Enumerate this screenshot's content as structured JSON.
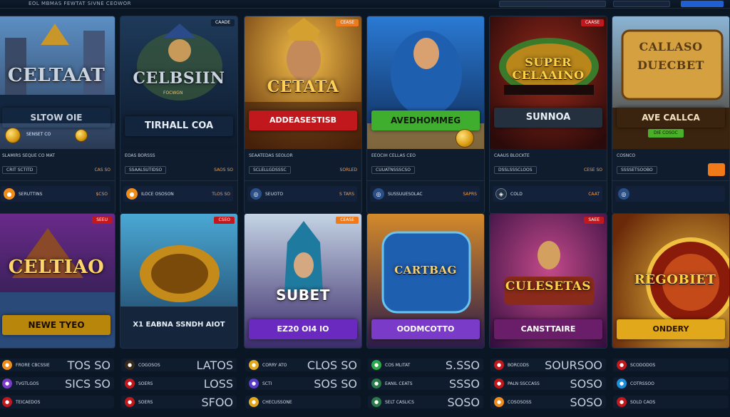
{
  "topbar": {
    "brand": "EOL MBMAS FEWTAT SIVNE CEOWOR"
  },
  "row1": [
    {
      "tag": "",
      "tag_color": "#1d5fd6",
      "logo": "CELTAAT",
      "logo_color": "#ffd46a",
      "banner": "SLTOW OIE",
      "banner_sub": "SENSET CO",
      "banner_bg": "#1d5fd6",
      "banner_fg": "#e8f2ff",
      "meta": "SLAMIRS SEQUE CO MAT",
      "chip": "CRIT SCTITD",
      "amount": "CAS SO",
      "pay_icon": "coin",
      "pay_color": "#f08c1a",
      "pay_label": "SERUTTINS",
      "pay_amount": "$CSO"
    },
    {
      "tag": "CAADE",
      "tag_color": "#12243a",
      "logo": "CELBSIIN",
      "logo_color": "#e7c470",
      "banner": "TIRHALL COA",
      "banner_sub": "FOCWGN",
      "banner_bg": "#13253c",
      "banner_fg": "#e6edf5",
      "meta": "EOAS BORSSS",
      "chip": "SSAALSUTIDSO",
      "amount": "SAOS SO",
      "pay_icon": "coin",
      "pay_color": "#f08c1a",
      "pay_label": "ILOCE OSOSON",
      "pay_amount": "TLOS SO"
    },
    {
      "tag": "CEASE",
      "tag_color": "#f07a1a",
      "logo": "CETATA",
      "logo_color": "#ffcf5a",
      "banner": "ADDEASESTISB",
      "banner_sub": "",
      "banner_bg": "#c0181c",
      "banner_fg": "#ffffff",
      "meta": "SEAATEDAS SEOLOR",
      "chip": "SCLELLGDSSSC",
      "amount": "SORLED",
      "pay_icon": "globe",
      "pay_color": "#2a4f86",
      "pay_label": "SEUOTO",
      "pay_amount": "S TARS"
    },
    {
      "tag": "",
      "tag_color": "#1d5fd6",
      "logo": "",
      "logo_color": "#ffffff",
      "banner": "AVEDHOMMEG",
      "banner_sub": "",
      "banner_bg": "#3fae2e",
      "banner_fg": "#0b1d07",
      "meta": "EEOCIH CELLAS CEO",
      "chip": "CUUATNSSSCSO",
      "amount": "",
      "pay_icon": "globe",
      "pay_color": "#2a4f86",
      "pay_label": "SUSSUUESOLAC",
      "pay_amount": "SAPRS"
    },
    {
      "tag": "CAASE",
      "tag_color": "#c0181c",
      "logo": "SUPER CELAAINO",
      "logo_color": "#ffd24a",
      "banner": "SUNNOA",
      "banner_sub": "",
      "banner_bg": "#24303d",
      "banner_fg": "#e8eef5",
      "meta": "CAAUS BLOCKTE",
      "chip": "DSSLSSSCLOOS",
      "amount": "CESE SO",
      "pay_icon": "coin",
      "pay_color": "#233345",
      "pay_label": "COLD",
      "pay_amount": "CAAT"
    },
    {
      "tag": "",
      "tag_color": "#1d5fd6",
      "logo": "CALLASO DUECBET",
      "logo_color": "#5a3a10",
      "banner": "AVE CALLCA",
      "banner_sub": "DIE COSOC",
      "banner_bg": "#3a2410",
      "banner_fg": "#f3e3c0",
      "meta": "COSNCO",
      "chip": "SSSSETSOOBO",
      "amount": "",
      "pay_icon": "globe",
      "pay_color": "#2a4f86",
      "pay_label": "",
      "pay_amount": ""
    }
  ],
  "row2": [
    {
      "tag": "SEEU",
      "tag_color": "#c0181c",
      "logo": "CELTIAO",
      "logo_color": "#ffd46a",
      "banner": "NEWE TYEO",
      "banner_bg": "#b8860b",
      "banner_fg": "#1a0e00",
      "bottom": [
        {
          "icon": "O",
          "color": "#f08c1a",
          "label": "FRORE CBCSSIE",
          "amount": "TOS SO"
        },
        {
          "icon": "O",
          "color": "#7a3cc8",
          "label": "TVGTLGOS",
          "amount": "SICS SO"
        },
        {
          "icon": "O",
          "color": "#c0181c",
          "label": "TEICAEDOS",
          "amount": ""
        }
      ]
    },
    {
      "tag": "CSEO",
      "tag_color": "#c0181c",
      "logo": "",
      "logo_color": "#ffffff",
      "banner": "X1 EABNA SSNDH AIOT",
      "banner_bg": "#15263c",
      "banner_fg": "#e6edf5",
      "bottom": [
        {
          "icon": "O",
          "color": "#3a2a1a",
          "label": "COGOSOS",
          "amount": "LATOS"
        },
        {
          "icon": "O",
          "color": "#c0181c",
          "label": "SOERS",
          "amount": "LOSS"
        },
        {
          "icon": "O",
          "color": "#c0181c",
          "label": "SOERS",
          "amount": "SFOO"
        }
      ]
    },
    {
      "tag": "CEASE",
      "tag_color": "#f07a1a",
      "logo": "SUBET",
      "logo_color": "#ffffff",
      "banner": "EZ20 OI4 IO",
      "banner_bg": "#6a2ac0",
      "banner_fg": "#ffffff",
      "bottom": [
        {
          "icon": "O",
          "color": "#e0a81a",
          "label": "CORRY ATO",
          "amount": "CLOS SO"
        },
        {
          "icon": "O",
          "color": "#5a3cc8",
          "label": "SCTI",
          "amount": "SOS SO"
        },
        {
          "icon": "O",
          "color": "#e0a81a",
          "label": "CHECUSSONE",
          "amount": ""
        }
      ]
    },
    {
      "tag": "",
      "tag_color": "#1d5fd6",
      "logo": "CARTBAG",
      "logo_color": "#f2d27a",
      "banner": "OODMCOTTO",
      "banner_bg": "#7a3cc8",
      "banner_fg": "#ffffff",
      "bottom": [
        {
          "icon": "O",
          "color": "#2aa84a",
          "label": "COS MLITAT",
          "amount": "S.SSO"
        },
        {
          "icon": "O",
          "color": "#2a7a4a",
          "label": "EANIL CEATS",
          "amount": "SSSO"
        },
        {
          "icon": "O",
          "color": "#2a7a4a",
          "label": "SELT CASLICS",
          "amount": "SOSO"
        }
      ]
    },
    {
      "tag": "SAEE",
      "tag_color": "#c0181c",
      "logo": "CULESETAS",
      "logo_color": "#ffd24a",
      "banner": "CANSTTAIRE",
      "banner_bg": "#6a1e6a",
      "banner_fg": "#ffffff",
      "bottom": [
        {
          "icon": "O",
          "color": "#c0181c",
          "label": "BORCODS",
          "amount": "SOURSOO"
        },
        {
          "icon": "O",
          "color": "#c0181c",
          "label": "PALN SSCCASS",
          "amount": "SOSO"
        },
        {
          "icon": "O",
          "color": "#f08c1a",
          "label": "COSOSOSS",
          "amount": "SOSO"
        }
      ]
    },
    {
      "tag": "",
      "tag_color": "#1d5fd6",
      "logo": "REGOBIET",
      "logo_color": "#ffd24a",
      "banner": "ONDERY",
      "banner_bg": "#e0a81a",
      "banner_fg": "#2a1600",
      "bottom": [
        {
          "icon": "O",
          "color": "#c0181c",
          "label": "SCODODOS",
          "amount": ""
        },
        {
          "icon": "O",
          "color": "#1d8fd6",
          "label": "COTRSSOO",
          "amount": ""
        },
        {
          "icon": "O",
          "color": "#c0181c",
          "label": "SOLD CAOS",
          "amount": ""
        }
      ]
    }
  ]
}
